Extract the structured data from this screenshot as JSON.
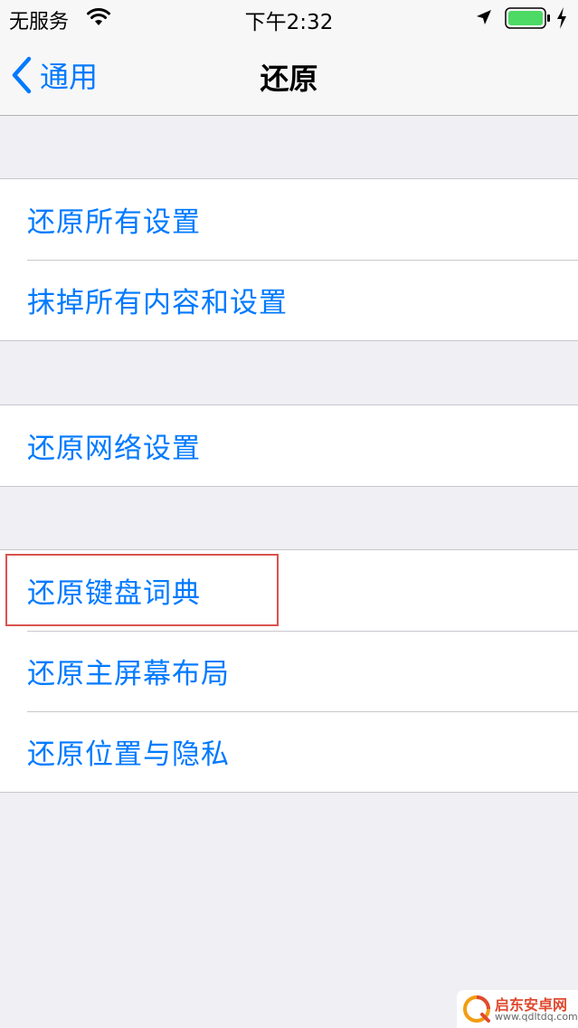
{
  "status_bar": {
    "carrier": "无服务",
    "time": "下午2:32"
  },
  "nav": {
    "back_label": "通用",
    "title": "还原"
  },
  "groups": [
    {
      "items": [
        {
          "label": "还原所有设置"
        },
        {
          "label": "抹掉所有内容和设置"
        }
      ]
    },
    {
      "items": [
        {
          "label": "还原网络设置"
        }
      ]
    },
    {
      "items": [
        {
          "label": "还原键盘词典"
        },
        {
          "label": "还原主屏幕布局"
        },
        {
          "label": "还原位置与隐私"
        }
      ]
    }
  ],
  "watermark": {
    "name": "启东安卓网",
    "url": "www.qdltdq.com"
  },
  "colors": {
    "accent": "#007aff",
    "background": "#efeff4",
    "highlight": "#d9534f",
    "battery": "#4cd964"
  }
}
